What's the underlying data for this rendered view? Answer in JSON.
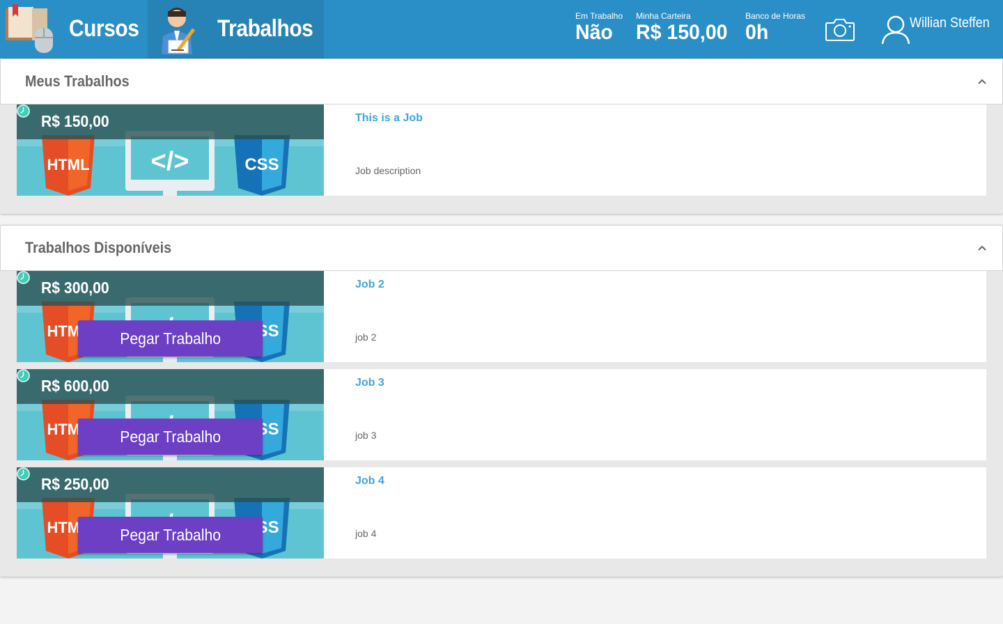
{
  "header": {
    "tabs": [
      {
        "label": "Cursos"
      },
      {
        "label": "Trabalhos"
      }
    ],
    "stats": {
      "em_trabalho": {
        "caption": "Em Trabalho",
        "value": "Não"
      },
      "carteira": {
        "caption": "Minha Carteira",
        "value": "R$ 150,00"
      },
      "banco_horas": {
        "caption": "Banco de Horas",
        "value": "0h"
      }
    },
    "camera_icon": "camera-icon",
    "user": {
      "name": "Willian Steffen",
      "icon": "user-icon"
    }
  },
  "meus_trabalhos": {
    "title": "Meus Trabalhos",
    "jobs": [
      {
        "price": "R$ 150,00",
        "title": "This is a Job",
        "description": "Job description"
      }
    ]
  },
  "disponiveis": {
    "title": "Trabalhos Disponíveis",
    "button_label": "Pegar Trabalho",
    "jobs": [
      {
        "price": "R$ 300,00",
        "title": "Job 2",
        "description": "job 2"
      },
      {
        "price": "R$ 600,00",
        "title": "Job 3",
        "description": "job 3"
      },
      {
        "price": "R$ 250,00",
        "title": "Job 4",
        "description": "job 4"
      }
    ]
  },
  "thumbnail": {
    "html_label": "HTML",
    "css_label": "CSS",
    "code_label": "</>"
  },
  "colors": {
    "header": "#2a8fc6",
    "accent": "#3ea6d8",
    "button": "#6c3fc4"
  }
}
